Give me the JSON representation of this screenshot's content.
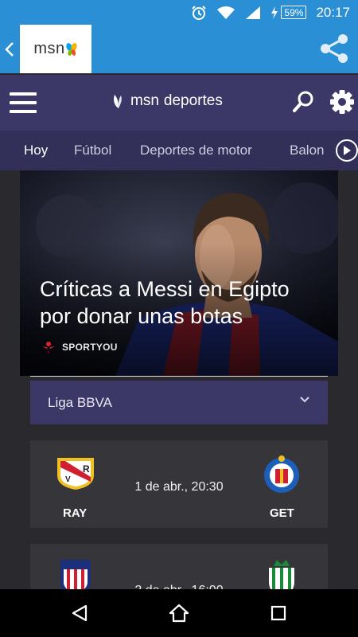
{
  "status": {
    "battery": "59%",
    "time": "20:17"
  },
  "app_bar": {
    "logo_text": "msn"
  },
  "header": {
    "brand_msn": "msn",
    "brand_section": "deportes"
  },
  "tabs": [
    {
      "label": "Hoy",
      "active": true
    },
    {
      "label": "Fútbol",
      "active": false
    },
    {
      "label": "Deportes de motor",
      "active": false
    },
    {
      "label": "Balon",
      "active": false
    }
  ],
  "hero": {
    "title": "Críticas a Messi en Egipto por donar unas botas",
    "source": "SPORTYOU"
  },
  "league": {
    "selected": "Liga BBVA"
  },
  "matches": [
    {
      "home": "RAY",
      "away": "GET",
      "datetime": "1 de abr., 20:30"
    },
    {
      "home": "",
      "away": "",
      "datetime": "2 de abr., 16:00"
    }
  ],
  "colors": {
    "accent": "#2b8fd6",
    "header": "#3b3766",
    "tabs": "#322f58",
    "card": "#35353a"
  }
}
